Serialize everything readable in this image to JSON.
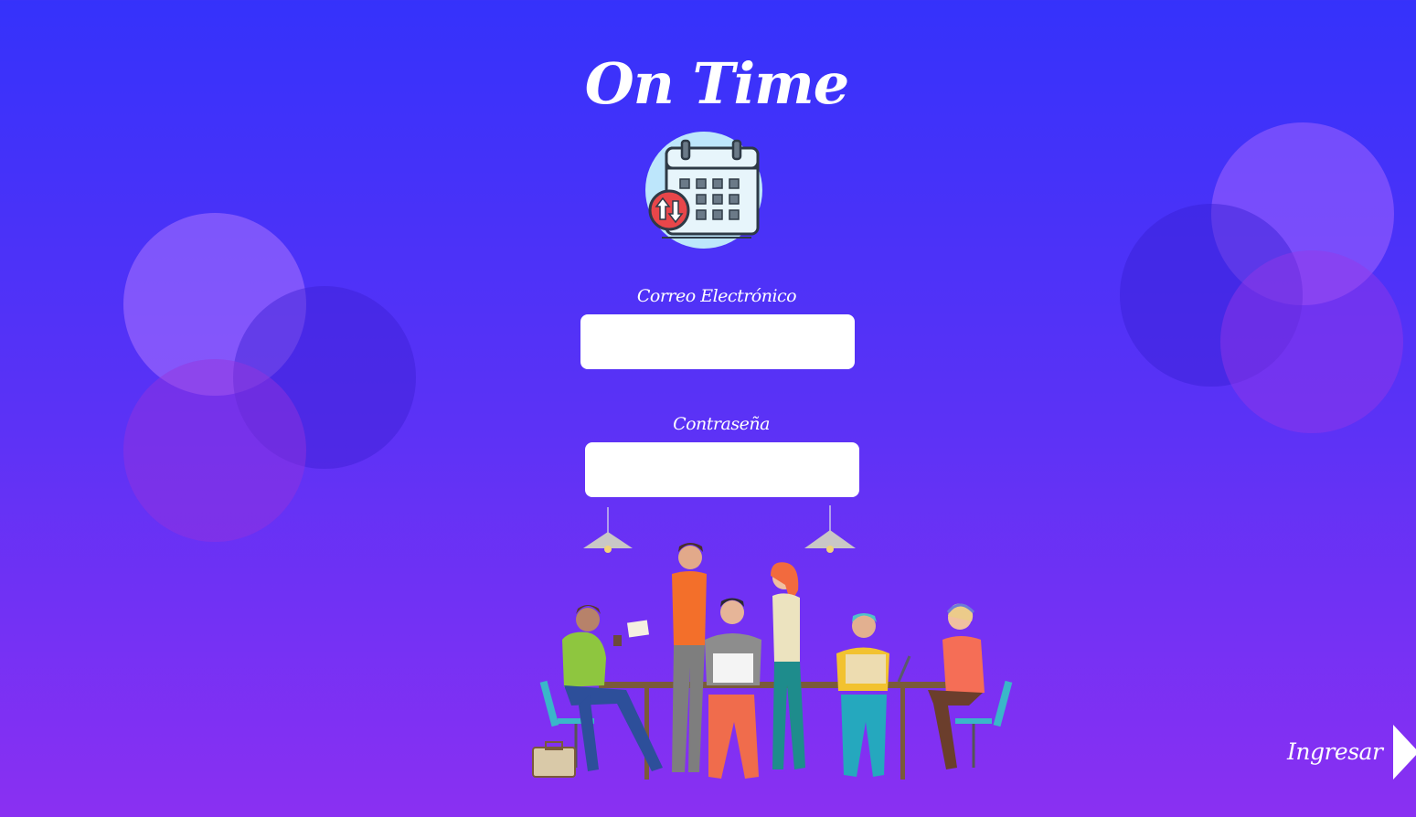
{
  "app": {
    "title": "On Time"
  },
  "logo": {
    "icon": "calendar-sync-icon"
  },
  "form": {
    "email_label": "Correo Electrónico",
    "email_value": "",
    "password_label": "Contraseña",
    "password_value": "",
    "submit_label": "Ingresar",
    "submit_icon": "play-arrow-icon"
  },
  "illustration": {
    "icon": "team-meeting-illustration"
  },
  "colors": {
    "background_top": "#3532fb",
    "background_bottom": "#8a30f2",
    "input_background": "#ffffff",
    "text": "#ffffff"
  }
}
